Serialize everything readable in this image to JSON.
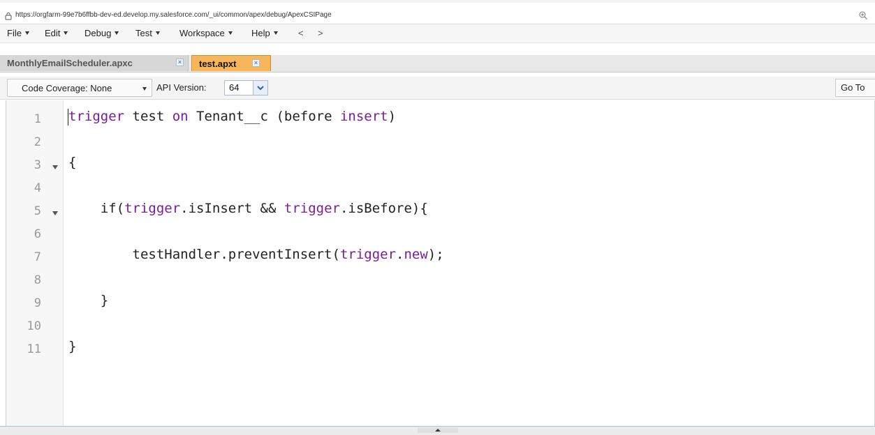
{
  "browser": {
    "url": "https://orgfarm-99e7b6ffbb-dev-ed.develop.my.salesforce.com/_ui/common/apex/debug/ApexCSIPage"
  },
  "menu": {
    "items": [
      {
        "label": "File"
      },
      {
        "label": "Edit"
      },
      {
        "label": "Debug"
      },
      {
        "label": "Test"
      },
      {
        "label": "Workspace"
      },
      {
        "label": "Help"
      }
    ],
    "back": "<",
    "forward": ">"
  },
  "tabs": [
    {
      "label": "MonthlyEmailScheduler.apxc",
      "active": false
    },
    {
      "label": "test.apxt",
      "active": true
    }
  ],
  "toolbar": {
    "code_coverage_label": "Code Coverage: None",
    "api_version_label": "API Version:",
    "api_version_value": "64",
    "goto_label": "Go To"
  },
  "editor": {
    "line_numbers": [
      "1",
      "2",
      "3",
      "4",
      "5",
      "6",
      "7",
      "8",
      "9",
      "10",
      "11"
    ],
    "lines": [
      {
        "plain_1": "",
        "kw_1": "trigger",
        "plain_2": " test ",
        "kw_2": "on",
        "plain_3": " Tenant__c (before ",
        "kw_3": "insert",
        "plain_4": ")"
      },
      {},
      {
        "plain_1": "{"
      },
      {},
      {
        "plain_1": "    if(",
        "kw_1": "trigger",
        "plain_2": ".isInsert && ",
        "kw_2": "trigger",
        "plain_3": ".isBefore){"
      },
      {},
      {
        "plain_1": "        testHandler.preventInsert(",
        "kw_1": "trigger",
        "plain_2": ".",
        "kw_2": "new",
        "plain_3": ");"
      },
      {},
      {
        "plain_1": "    }"
      },
      {},
      {
        "plain_1": "}"
      }
    ]
  },
  "icons": {
    "lock": "lock-icon",
    "zoom": "zoom-icon",
    "close": "close-icon",
    "fold": "fold-arrow-icon"
  },
  "colors": {
    "active_tab": "#f7b65a",
    "keyword": "#7a1c9a"
  }
}
